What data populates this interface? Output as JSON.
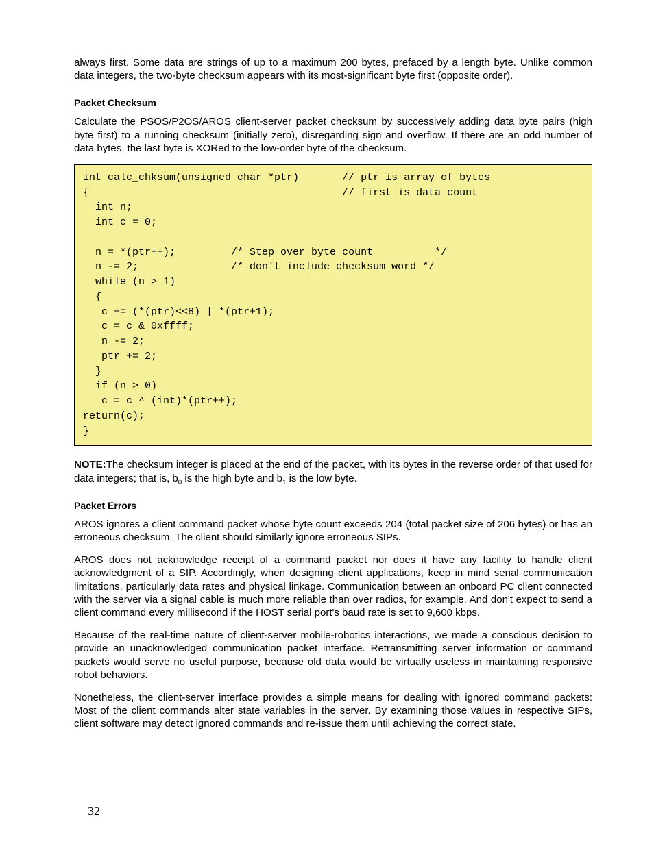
{
  "top_para": "always first.  Some data are strings of up to a maximum 200 bytes, prefaced by a length byte.  Unlike common data integers, the two-byte checksum appears with its most-significant byte first (opposite order).",
  "h1": "Packet Checksum",
  "p1": "Calculate the PSOS/P2OS/AROS client-server packet checksum by successively adding data byte pairs (high byte first) to a running checksum (initially zero), disregarding sign and overflow.   If there are an odd number of data bytes, the last byte is XORed to the low-order byte of the checksum.",
  "code": "int calc_chksum(unsigned char *ptr)       // ptr is array of bytes\n{                                         // first is data count\n  int n;\n  int c = 0;\n\n  n = *(ptr++);         /* Step over byte count          */\n  n -= 2;               /* don't include checksum word */\n  while (n > 1)\n  {\n   c += (*(ptr)<<8) | *(ptr+1);\n   c = c & 0xffff;\n   n -= 2;\n   ptr += 2;\n  }\n  if (n > 0)\n   c = c ^ (int)*(ptr++);\nreturn(c);\n}",
  "note_label": "NOTE:",
  "note_a": "The checksum integer is placed at the end of the packet, with its bytes in the reverse order of that used for data integers; that is, b",
  "note_b": " is the high byte and b",
  "note_c": " is the low byte.",
  "sub0": "0",
  "sub1": "1",
  "h2": "Packet Errors",
  "p2": "AROS ignores a client command packet whose byte count exceeds 204 (total packet size of 206 bytes) or has an erroneous checksum.  The client should similarly ignore erroneous SIPs.",
  "p3": "AROS does not acknowledge receipt of a command packet nor does it have any facility to handle client acknowledgment of a SIP. Accordingly, when designing client applications, keep in mind serial communication limitations, particularly data rates and physical linkage.  Communication between an onboard PC client connected with the server via a signal cable is much more reliable than over radios, for example.  And don't expect to send a client command every millisecond if the HOST serial port's baud rate is set to 9,600 kbps.",
  "p4": "Because of the real-time nature of client-server mobile-robotics interactions, we made a conscious decision to provide an unacknowledged communication packet interface. Retransmitting server information or command packets would serve no useful purpose, because old data would be virtually useless in maintaining responsive robot behaviors.",
  "p5": "Nonetheless, the client-server interface provides a simple means for dealing with ignored command packets:  Most of the client commands alter state variables in the server.   By examining those values in respective SIPs, client software may detect ignored commands and re-issue them until achieving the correct state.",
  "page_number": "32"
}
